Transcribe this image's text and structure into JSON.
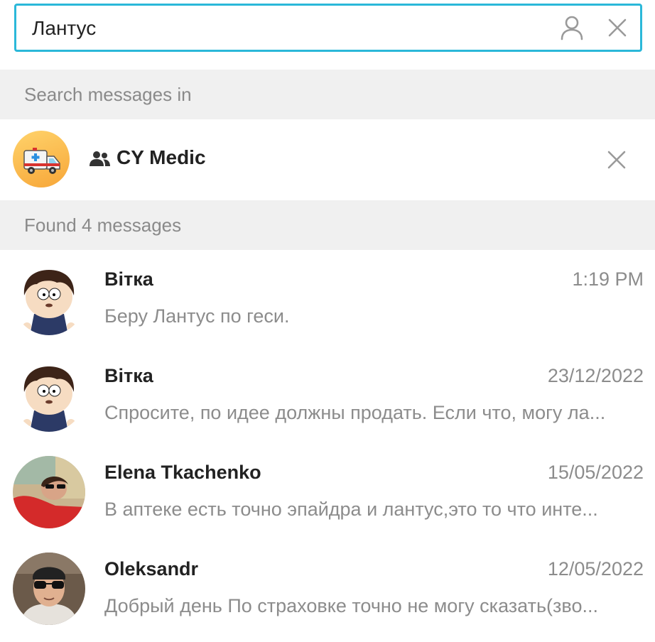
{
  "search": {
    "value": "Лантус",
    "person_icon": "person-icon",
    "clear_icon": "close-icon",
    "accent_color": "#2bb8d9"
  },
  "sections": {
    "search_in": "Search messages in",
    "found": "Found 4 messages"
  },
  "chat": {
    "name": "CY Medic",
    "avatar_icon": "ambulance-icon",
    "type_icon": "group-icon",
    "remove_icon": "close-icon"
  },
  "results": [
    {
      "name": "Вітка",
      "date": "1:19 PM",
      "text": "Беру Лантус по геси.",
      "avatar": "cartoon-avatar"
    },
    {
      "name": "Вітка",
      "date": "23/12/2022",
      "text": "Спросите, по идее должны продать. Если что, могу ла...",
      "avatar": "cartoon-avatar"
    },
    {
      "name": "Elena Tkachenko",
      "date": "15/05/2022",
      "text": "В аптеке есть точно эпайдра и лантус,это то что инте...",
      "avatar": "photo-avatar"
    },
    {
      "name": "Oleksandr",
      "date": "12/05/2022",
      "text": "Добрый день По страховке точно не могу сказать(зво...",
      "avatar": "photo-avatar"
    }
  ]
}
